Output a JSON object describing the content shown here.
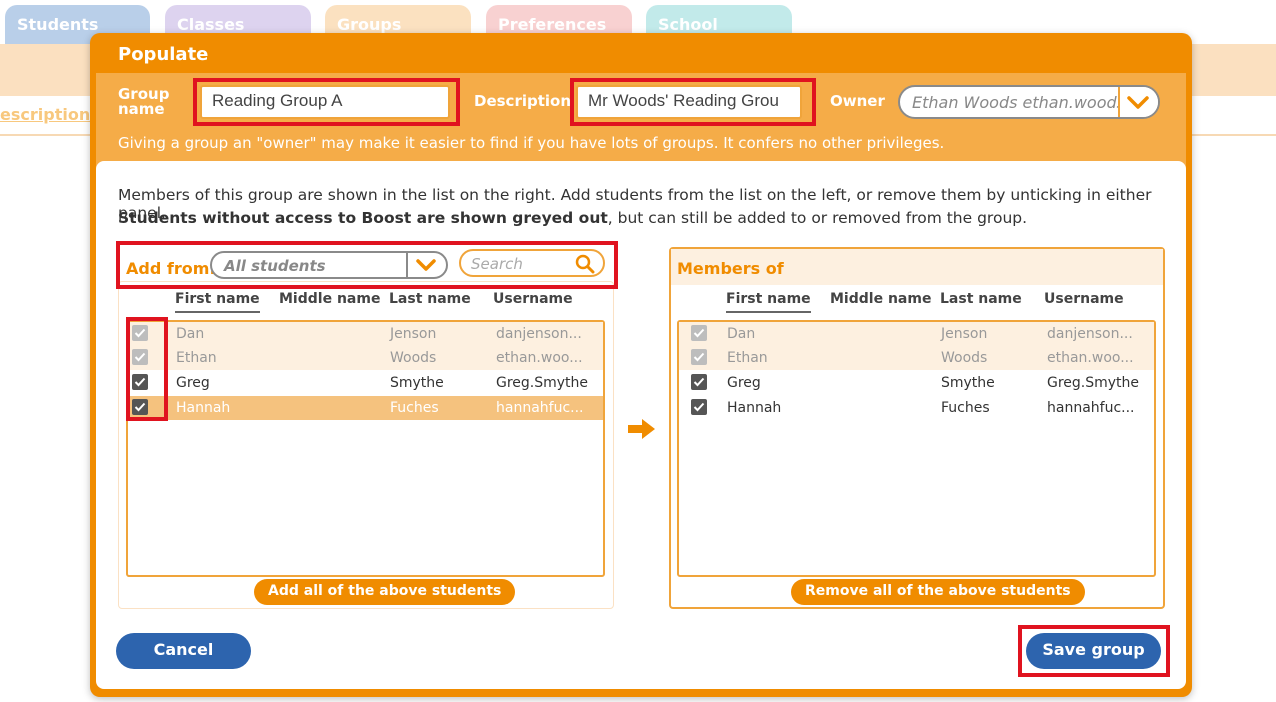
{
  "background_tabs": [
    {
      "label": "Students",
      "color": "#4f86c6"
    },
    {
      "label": "Classes",
      "color": "#b39ddb"
    },
    {
      "label": "Groups",
      "color": "#f5c27e"
    },
    {
      "label": "Preferences",
      "color": "#f4a3a3"
    },
    {
      "label": "School",
      "color": "#80d4d4"
    }
  ],
  "background": {
    "description_link": "escription"
  },
  "modal": {
    "title": "Populate",
    "group_name_label_line1": "Group",
    "group_name_label_line2": "name",
    "group_name_value": "Reading Group A",
    "description_label": "Description",
    "description_value": "Mr Woods' Reading Grou",
    "owner_label": "Owner",
    "owner_value": "Ethan Woods ethan.woods@",
    "owner_hint": "Giving a group an \"owner\" may make it easier to find if you have lots of groups. It confers no other privileges.",
    "info_line1": "Members of this group are shown in the list on the right. Add students from the list on the left, or remove them by unticking in either panel.",
    "info_line2_bold": "Students without access to Boost are shown greyed out",
    "info_line2_rest": ", but can still be added to or removed from the group."
  },
  "left_panel": {
    "add_from_label": "Add from:",
    "source_value": "All students",
    "search_placeholder": "Search",
    "columns": [
      "First name",
      "Middle name",
      "Last name",
      "Username"
    ],
    "rows": [
      {
        "first": "Dan",
        "middle": "",
        "last": "Jenson",
        "username": "danjenson...",
        "checked": true,
        "state": "dim"
      },
      {
        "first": "Ethan",
        "middle": "",
        "last": "Woods",
        "username": "ethan.woo...",
        "checked": true,
        "state": "dim"
      },
      {
        "first": "Greg",
        "middle": "",
        "last": "Smythe",
        "username": "Greg.Smythe",
        "checked": true,
        "state": "normal"
      },
      {
        "first": "Hannah",
        "middle": "",
        "last": "Fuches",
        "username": "hannahfuc...",
        "checked": true,
        "state": "highlight"
      }
    ],
    "add_all_label": "Add all of the above students"
  },
  "right_panel": {
    "title": "Members of",
    "columns": [
      "First name",
      "Middle name",
      "Last name",
      "Username"
    ],
    "rows": [
      {
        "first": "Dan",
        "middle": "",
        "last": "Jenson",
        "username": "danjenson...",
        "checked": true,
        "state": "dim"
      },
      {
        "first": "Ethan",
        "middle": "",
        "last": "Woods",
        "username": "ethan.woo...",
        "checked": true,
        "state": "dim"
      },
      {
        "first": "Greg",
        "middle": "",
        "last": "Smythe",
        "username": "Greg.Smythe",
        "checked": true,
        "state": "normal"
      },
      {
        "first": "Hannah",
        "middle": "",
        "last": "Fuches",
        "username": "hannahfuc...",
        "checked": true,
        "state": "normal"
      }
    ],
    "remove_all_label": "Remove all of the above students"
  },
  "buttons": {
    "cancel": "Cancel",
    "save": "Save group"
  },
  "colors": {
    "accent": "#f08c00",
    "accent_light": "#f5ac48",
    "button_blue": "#2d64ae",
    "highlight_red": "#e0131f"
  }
}
